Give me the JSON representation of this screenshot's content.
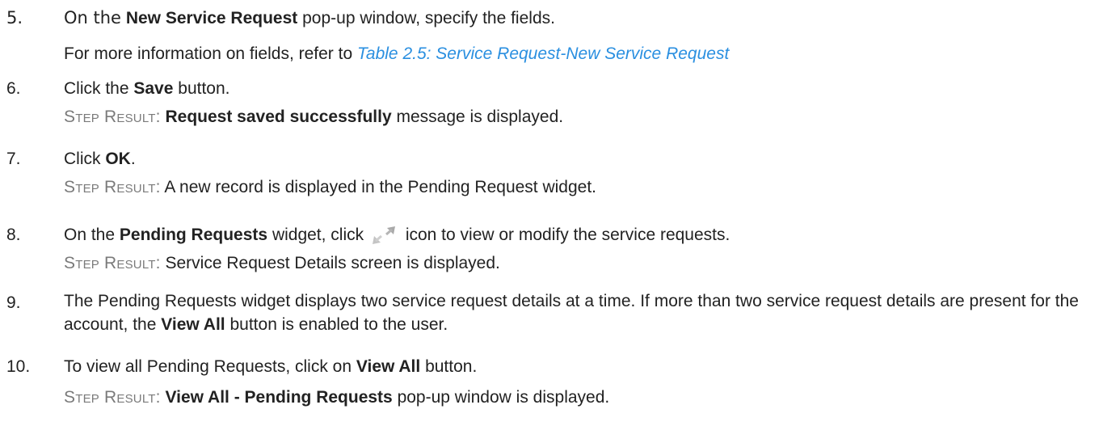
{
  "steps": [
    {
      "number": "5.",
      "intro": "On the",
      "bold": "New Service Request",
      "rest": "pop-up window, specify the fields.",
      "note_prefix": "For more information on fields, refer to",
      "note_link": "Table 2.5: Service Request-New Service Request"
    },
    {
      "number": "6.",
      "prefix": "Click the",
      "bold": "Save",
      "suffix": "button.",
      "result_label": "Step Result:",
      "result_bold": "Request saved successfully",
      "result_text": "message is displayed."
    },
    {
      "number": "7.",
      "prefix": "Click",
      "bold": "OK",
      "suffix": ".",
      "result_label": "Step Result:",
      "result_text": "A new record is displayed in the Pending Request widget."
    },
    {
      "number": "8.",
      "prefix": "On the",
      "bold": "Pending Requests",
      "middle": "widget, click",
      "icon": "expand-icon",
      "suffix": "icon to view or modify the service requests.",
      "result_label": "Step Result:",
      "result_text": "Service Request Details screen is displayed."
    },
    {
      "number": "9.",
      "text_before": "The Pending Requests widget displays two service request details at a time. If more than two service request details are present for the account, the",
      "bold": "View All",
      "text_after": "button is enabled to the user."
    },
    {
      "number": "10.",
      "prefix": "To view all Pending Requests, click on",
      "bold": "View All",
      "suffix": "button.",
      "result_label": "Step Result:",
      "result_bold": "View All - Pending Requests",
      "result_text": "pop-up window is displayed."
    }
  ],
  "colors": {
    "link": "#2a8fe0",
    "step_result": "#7a7a7a",
    "icon": "#b0b0b0"
  }
}
